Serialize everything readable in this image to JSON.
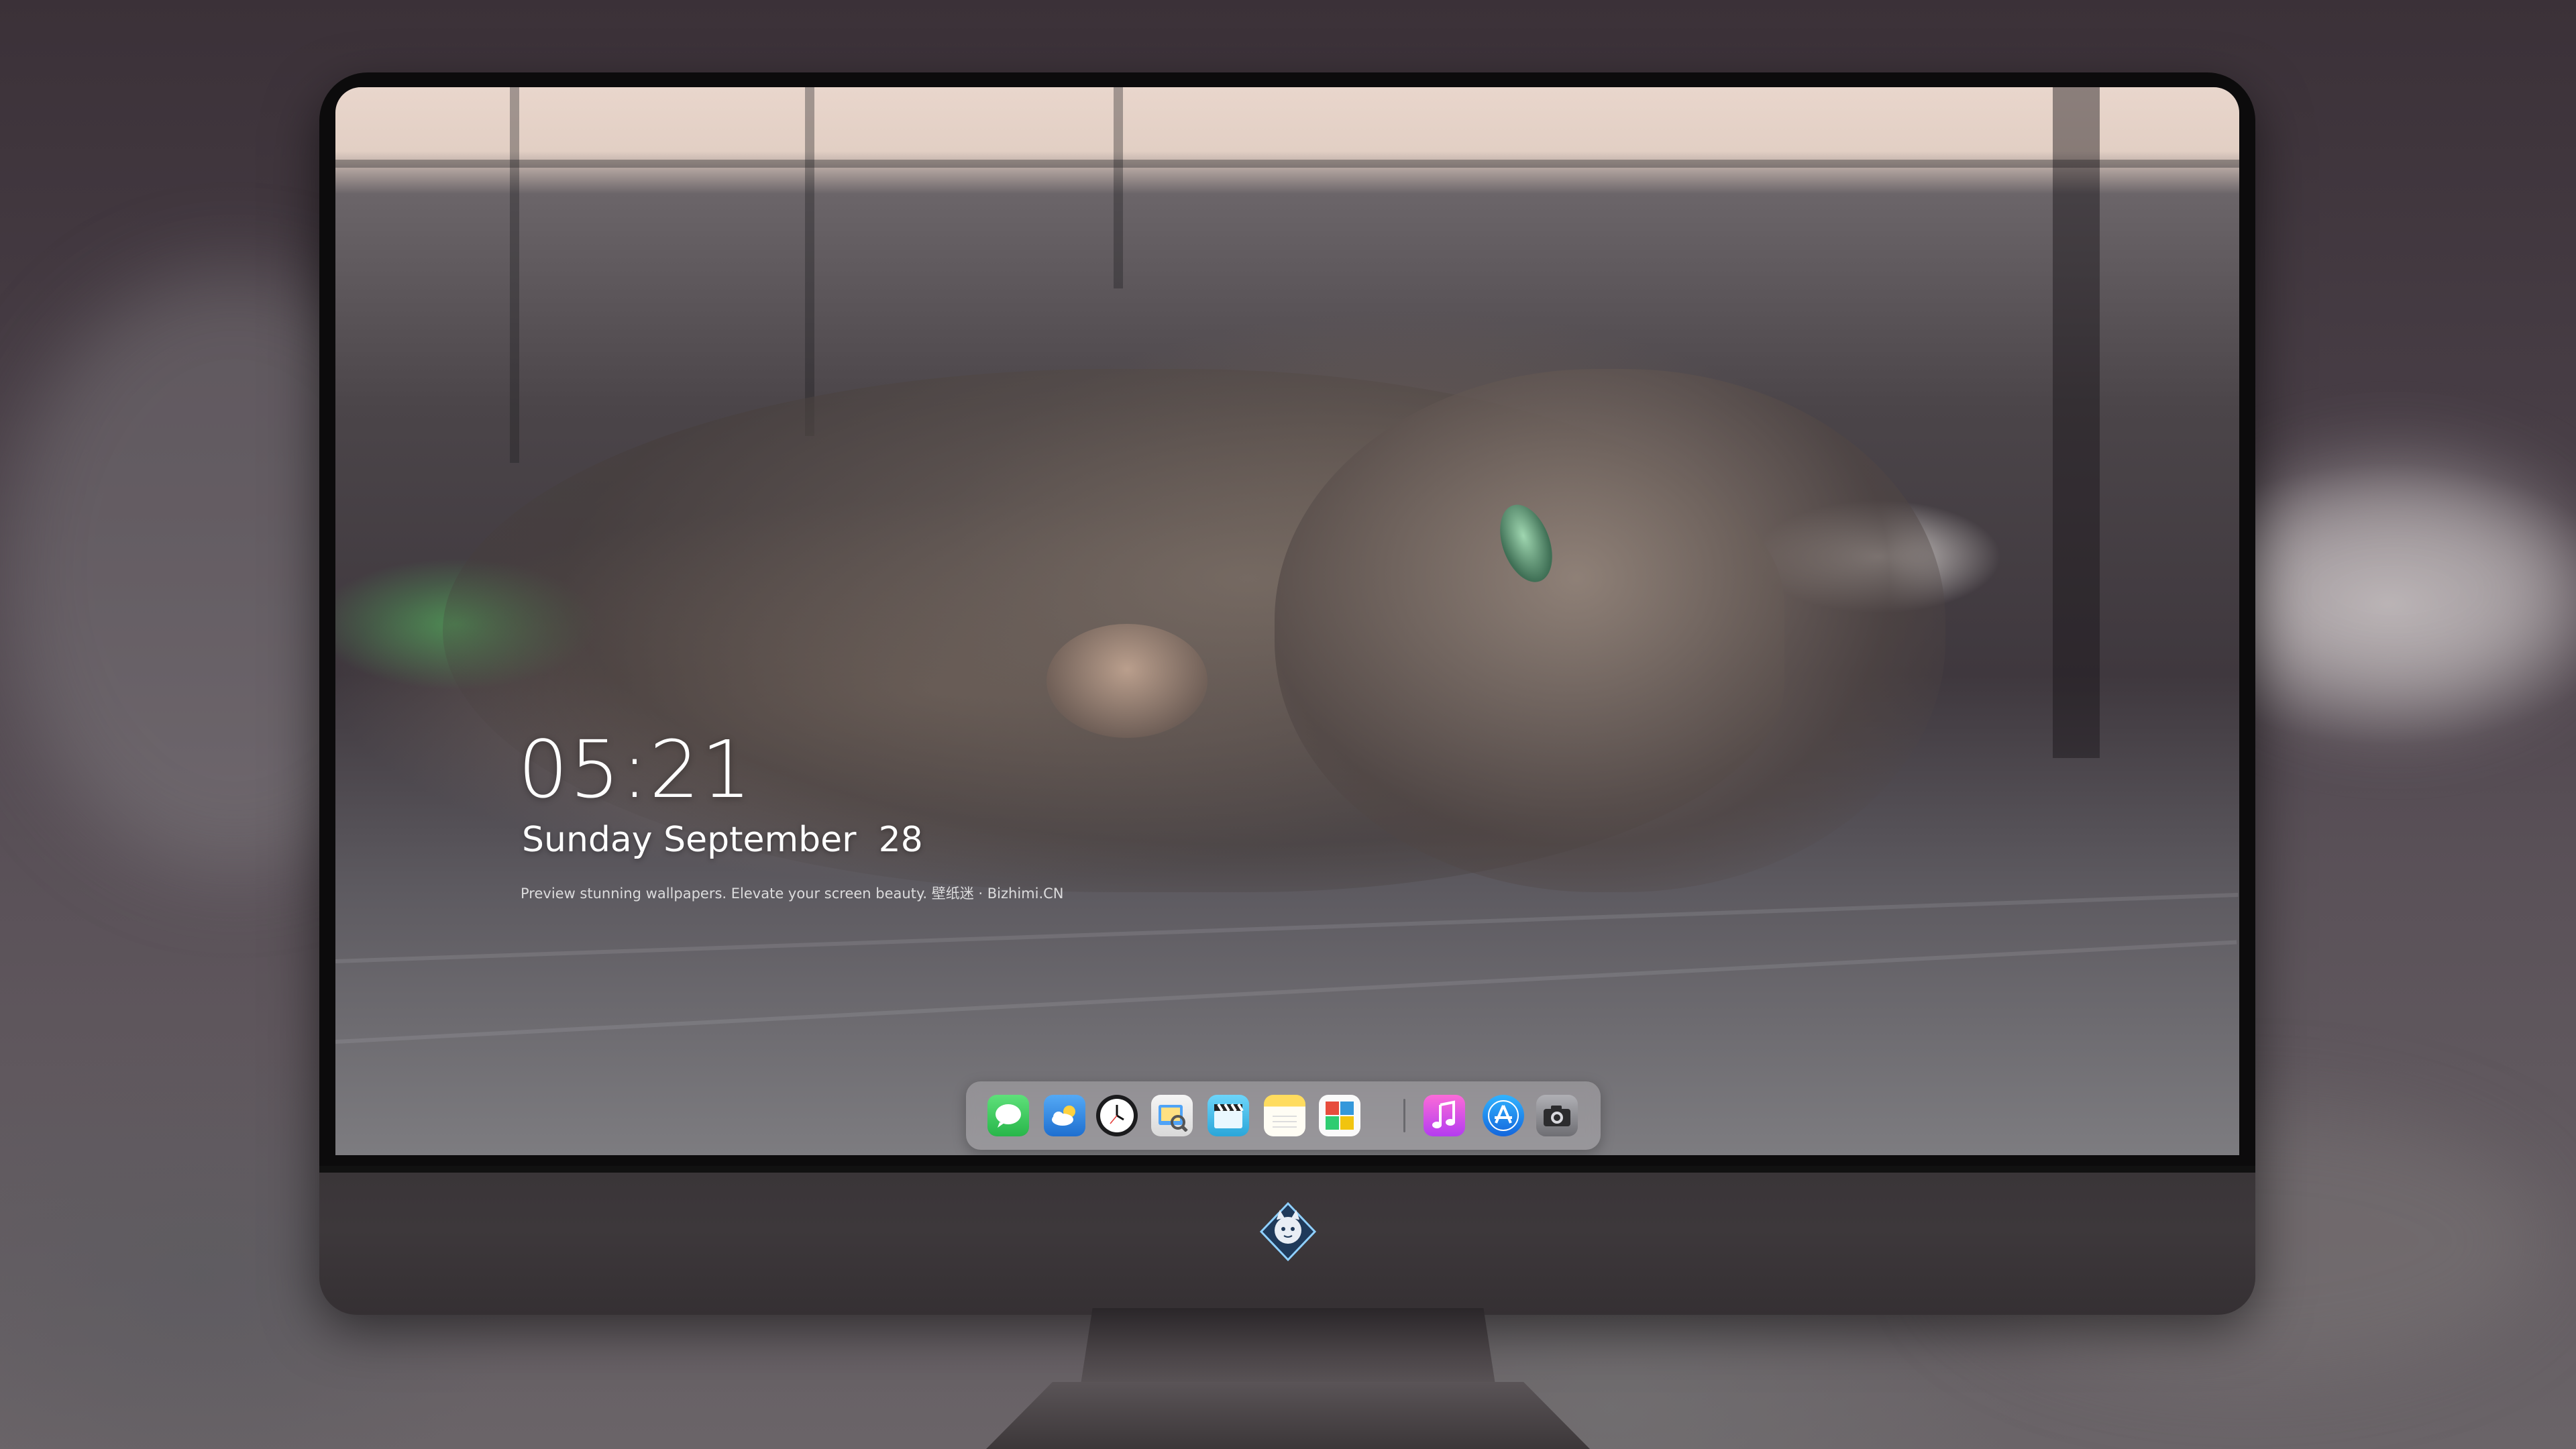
{
  "lockscreen": {
    "time": "05:21",
    "date": "Sunday September  28",
    "caption": "Preview stunning wallpapers. Elevate your screen beauty. 壁纸迷 · Bizhimi.CN"
  },
  "dock": {
    "items": [
      {
        "name": "messages",
        "icon": "chat-bubble-icon",
        "color": "#35c759"
      },
      {
        "name": "weather",
        "icon": "cloud-sun-icon",
        "color": "#2f8fe8"
      },
      {
        "name": "clock",
        "icon": "clock-icon",
        "color": "#1a1a1a"
      },
      {
        "name": "preview",
        "icon": "preview-icon",
        "color": "#f2c94c"
      },
      {
        "name": "clips",
        "icon": "clapperboard-icon",
        "color": "#4fc3f7"
      },
      {
        "name": "notes",
        "icon": "notes-icon",
        "color": "#ffd75a"
      },
      {
        "name": "photo-booth",
        "icon": "photo-booth-icon",
        "color": "#e74c3c"
      },
      {
        "name": "music",
        "icon": "music-note-icon",
        "color": "#e54cd0"
      },
      {
        "name": "app-store",
        "icon": "app-store-icon",
        "color": "#1e88e5"
      },
      {
        "name": "camera",
        "icon": "camera-icon",
        "color": "#8d8d92"
      }
    ]
  },
  "monitor": {
    "logo_icon": "mascot-logo-icon"
  }
}
